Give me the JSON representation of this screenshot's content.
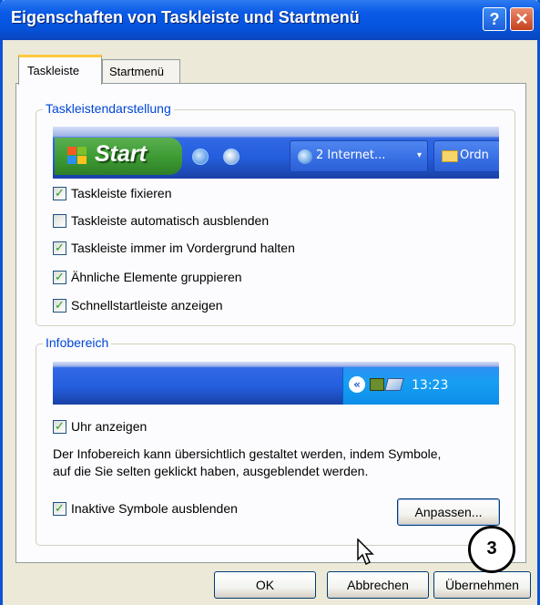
{
  "window": {
    "title": "Eigenschaften von Taskleiste und Startmenü",
    "help_glyph": "?",
    "close_glyph": "✕"
  },
  "tabs": [
    {
      "label": "Taskleiste",
      "active": true
    },
    {
      "label": "Startmenü",
      "active": false
    }
  ],
  "taskbar_group": {
    "legend": "Taskleistendarstellung",
    "preview": {
      "start_label": "Start",
      "task_buttons": [
        {
          "label": "2 Internet...",
          "icon": "ie-icon",
          "arrow": "▾"
        },
        {
          "label": "Ordn",
          "icon": "folder-icon"
        }
      ]
    },
    "options": [
      {
        "label": "Taskleiste fixieren",
        "checked": true
      },
      {
        "label": "Taskleiste automatisch ausblenden",
        "checked": false
      },
      {
        "label": "Taskleiste immer im Vordergrund halten",
        "checked": true
      },
      {
        "label": "Ähnliche Elemente gruppieren",
        "checked": true
      },
      {
        "label": "Schnellstartleiste anzeigen",
        "checked": true
      }
    ]
  },
  "tray_group": {
    "legend": "Infobereich",
    "preview": {
      "chevron": "«",
      "clock": "13:23"
    },
    "show_clock": {
      "label": "Uhr anzeigen",
      "checked": true
    },
    "info_line1": "Der Infobereich kann übersichtlich gestaltet werden, indem Symbole,",
    "info_line2": "auf die Sie selten geklickt haben, ausgeblendet werden.",
    "hide_inactive": {
      "label": "Inaktive Symbole ausblenden",
      "checked": true
    },
    "customize_label": "Anpassen..."
  },
  "buttons": {
    "ok": "OK",
    "cancel": "Abbrechen",
    "apply": "Übernehmen"
  },
  "annotation": {
    "step": "3"
  },
  "check_glyph": "✓",
  "colors": {
    "title_bar": "#0453dc",
    "legend_text": "#0046d5",
    "start_green": "#3c9a32",
    "taskbar_blue": "#245edc",
    "check_green": "#21a121"
  }
}
